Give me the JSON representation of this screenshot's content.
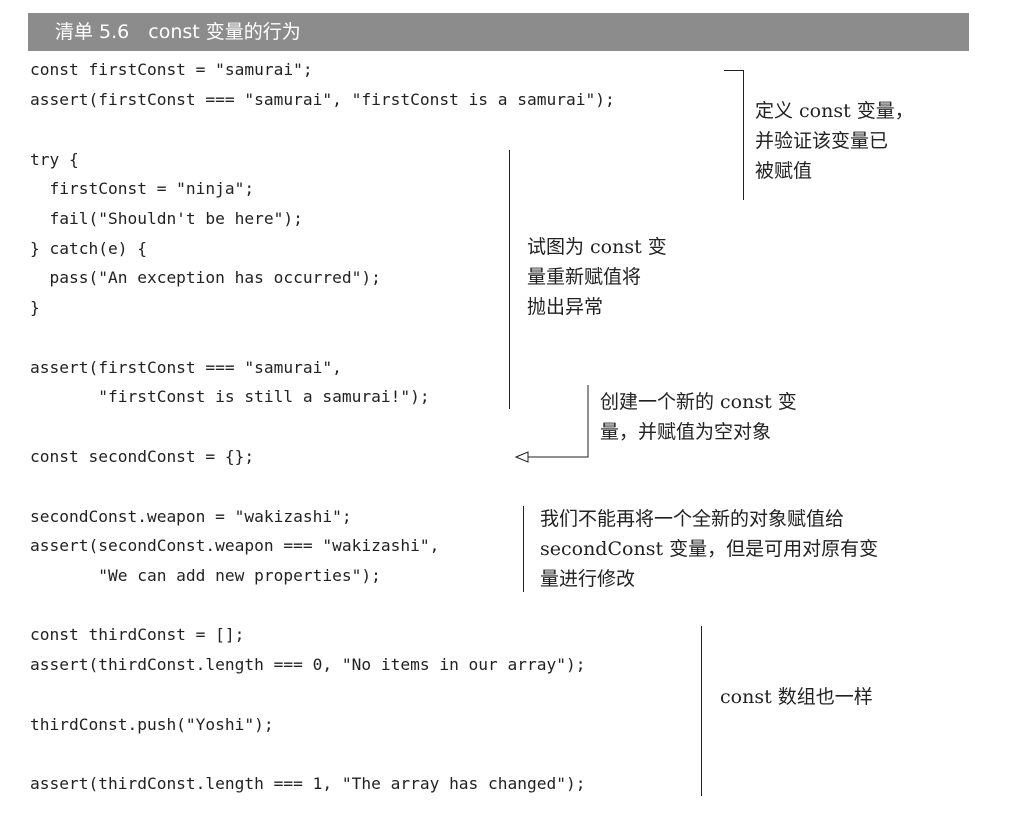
{
  "listing": {
    "title": "清单 5.6　const 变量的行为",
    "code_lines": [
      "const firstConst = \"samurai\";",
      "assert(firstConst === \"samurai\", \"firstConst is a samurai\");",
      "try {",
      "  firstConst = \"ninja\";",
      "  fail(\"Shouldn't be here\");",
      "} catch(e) {",
      "  pass(\"An exception has occurred\");",
      "}",
      "assert(firstConst === \"samurai\",",
      "       \"firstConst is still a samurai!\");",
      "const secondConst = {};",
      "secondConst.weapon = \"wakizashi\";",
      "assert(secondConst.weapon === \"wakizashi\",",
      "       \"We can add new properties\");",
      "const thirdConst = [];",
      "assert(thirdConst.length === 0, \"No items in our array\");",
      "thirdConst.push(\"Yoshi\");",
      "assert(thirdConst.length === 1, \"The array has changed\");"
    ]
  },
  "annotations": {
    "define_const": [
      "定义 const 变量，",
      "并验证该变量已",
      "被赋值"
    ],
    "reassign_throws": [
      "试图为 const 变",
      "量重新赋值将",
      "抛出异常"
    ],
    "create_new_const": [
      "创建一个新的 const 变",
      "量，并赋值为空对象"
    ],
    "modify_object": [
      "我们不能再将一个全新的对象赋值给",
      "secondConst 变量，但是可用对原有变",
      "量进行修改"
    ],
    "array_same": [
      "const 数组也一样"
    ]
  }
}
